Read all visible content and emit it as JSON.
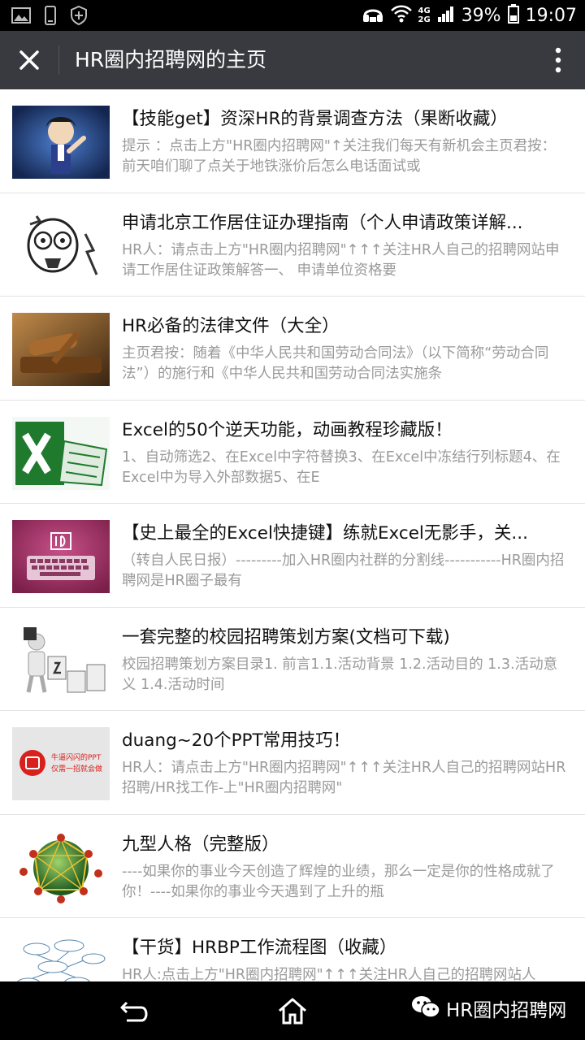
{
  "status_bar": {
    "icons": [
      "image-icon",
      "phone-icon",
      "shield-icon",
      "headset-icon",
      "wifi-icon",
      "signal-icon",
      "battery-icon"
    ],
    "network": [
      "4G",
      "2G"
    ],
    "battery": "39%",
    "time": "19:07"
  },
  "title_bar": {
    "title": "HR圈内招聘网的主页",
    "close_icon": "close-icon",
    "more_icon": "more-vertical-icon"
  },
  "articles": [
    {
      "title": "【技能get】资深HR的背景调查方法（果断收藏）",
      "desc": "提示 ：点击上方\"HR圈内招聘网\"↑关注我们每天有新机会主页君按：前天咱们聊了点关于地铁涨价后怎么电话面试或",
      "thumb_colors": [
        "#2a4a8a",
        "#1c2f5e"
      ]
    },
    {
      "title": "申请北京工作居住证办理指南（个人申请政策详解...",
      "desc": "HR人：请点击上方\"HR圈内招聘网\"↑↑↑关注HR人自己的招聘网站申请工作居住证政策解答一、 申请单位资格要",
      "thumb_colors": [
        "#ffffff",
        "#222222"
      ]
    },
    {
      "title": "HR必备的法律文件（大全）",
      "desc": "主页君按：随着《中华人民共和国劳动合同法》（以下简称“劳动合同法”）的施行和《中华人民共和国劳动合同法实施条",
      "thumb_colors": [
        "#8a5a24",
        "#3a2410"
      ]
    },
    {
      "title": "Excel的50个逆天功能，动画教程珍藏版！",
      "desc": "1、自动筛选2、在Excel中字符替换3、在Excel中冻结行列标题4、在Excel中为导入外部数据5、在E",
      "thumb_colors": [
        "#1f7a2e",
        "#e9f3e9"
      ]
    },
    {
      "title": "【史上最全的Excel快捷键】练就Excel无影手，关...",
      "desc": "（转自人民日报）---------加入HR圈内社群的分割线-----------HR圈内招聘网是HR圈子最有",
      "thumb_colors": [
        "#9b2a5a",
        "#c04a80"
      ]
    },
    {
      "title": "一套完整的校园招聘策划方案(文档可下载)",
      "desc": "校园招聘策划方案目录1. 前言1.1.活动背景 1.2.活动目的 1.3.活动意义 1.4.活动时间",
      "thumb_colors": [
        "#ffffff",
        "#333333"
      ]
    },
    {
      "title": "duang~20个PPT常用技巧！",
      "desc": "HR人：请点击上方\"HR圈内招聘网\"↑↑↑关注HR人自己的招聘网站HR招聘/HR找工作-上\"HR圈内招聘网\"",
      "thumb_colors": [
        "#e6e6e6",
        "#d8201c"
      ],
      "thumb_texts": [
        "牛逼闪闪的PPT",
        "仅需一招就会做"
      ]
    },
    {
      "title": "九型人格（完整版）",
      "desc": "----如果你的事业今天创造了辉煌的业绩，那么一定是你的性格成就了你！----如果你的事业今天遇到了上升的瓶",
      "thumb_colors": [
        "#2f7a2a",
        "#d9b23a"
      ]
    },
    {
      "title": "【干货】HRBP工作流程图（收藏）",
      "desc": "HR人:点击上方\"HR圈内招聘网\"↑↑↑关注HR人自己的招聘网站人",
      "thumb_colors": [
        "#ffffff",
        "#5a8ab0"
      ]
    }
  ],
  "nav_bar": {
    "icons": [
      "back-icon",
      "home-icon"
    ],
    "watermark": "HR圈内招聘网"
  }
}
